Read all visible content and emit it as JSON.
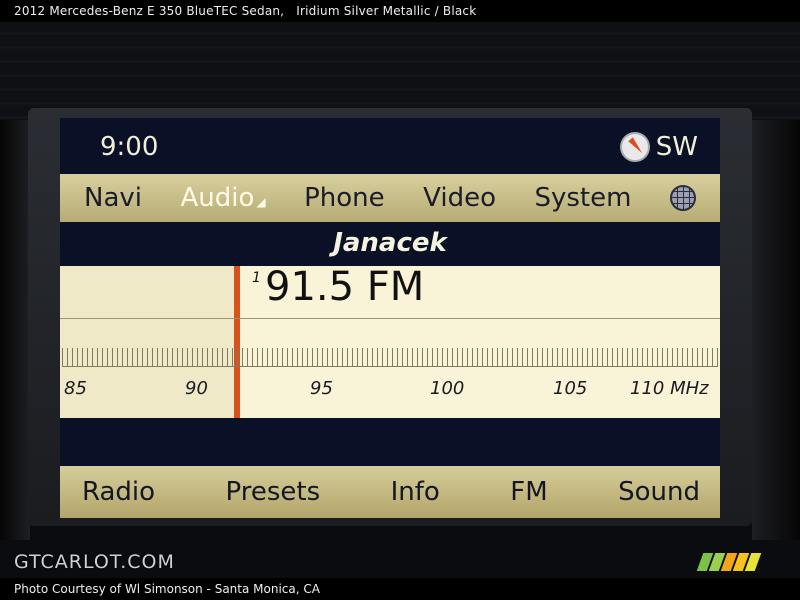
{
  "caption": {
    "vehicle": "2012 Mercedes-Benz E 350 BlueTEC Sedan,",
    "color": "Iridium Silver Metallic / Black"
  },
  "status": {
    "time": "9:00",
    "compass_direction": "SW"
  },
  "main_menu": {
    "items": [
      "Navi",
      "Audio",
      "Phone",
      "Video",
      "System"
    ],
    "active": "Audio"
  },
  "tuner": {
    "station_name": "Janacek",
    "preset_number": "1",
    "frequency": "91.5 FM",
    "scale_labels": [
      "85",
      "90",
      "95",
      "100",
      "105",
      "110 MHz"
    ]
  },
  "soft_keys": [
    "Radio",
    "Presets",
    "Info",
    "FM",
    "Sound"
  ],
  "footer": {
    "credit": "Photo Courtesy of Wl Simonson - Santa Monica, CA",
    "watermark": "GTCARLOT.COM"
  },
  "colors": {
    "menu_bar": "#d8cf9d",
    "tuner_bg": "#f9f4d7",
    "tuning_needle": "#d8521e",
    "screen_bg": "#0a1026"
  },
  "icons": {
    "compass": "compass-icon",
    "globe": "globe-icon"
  }
}
